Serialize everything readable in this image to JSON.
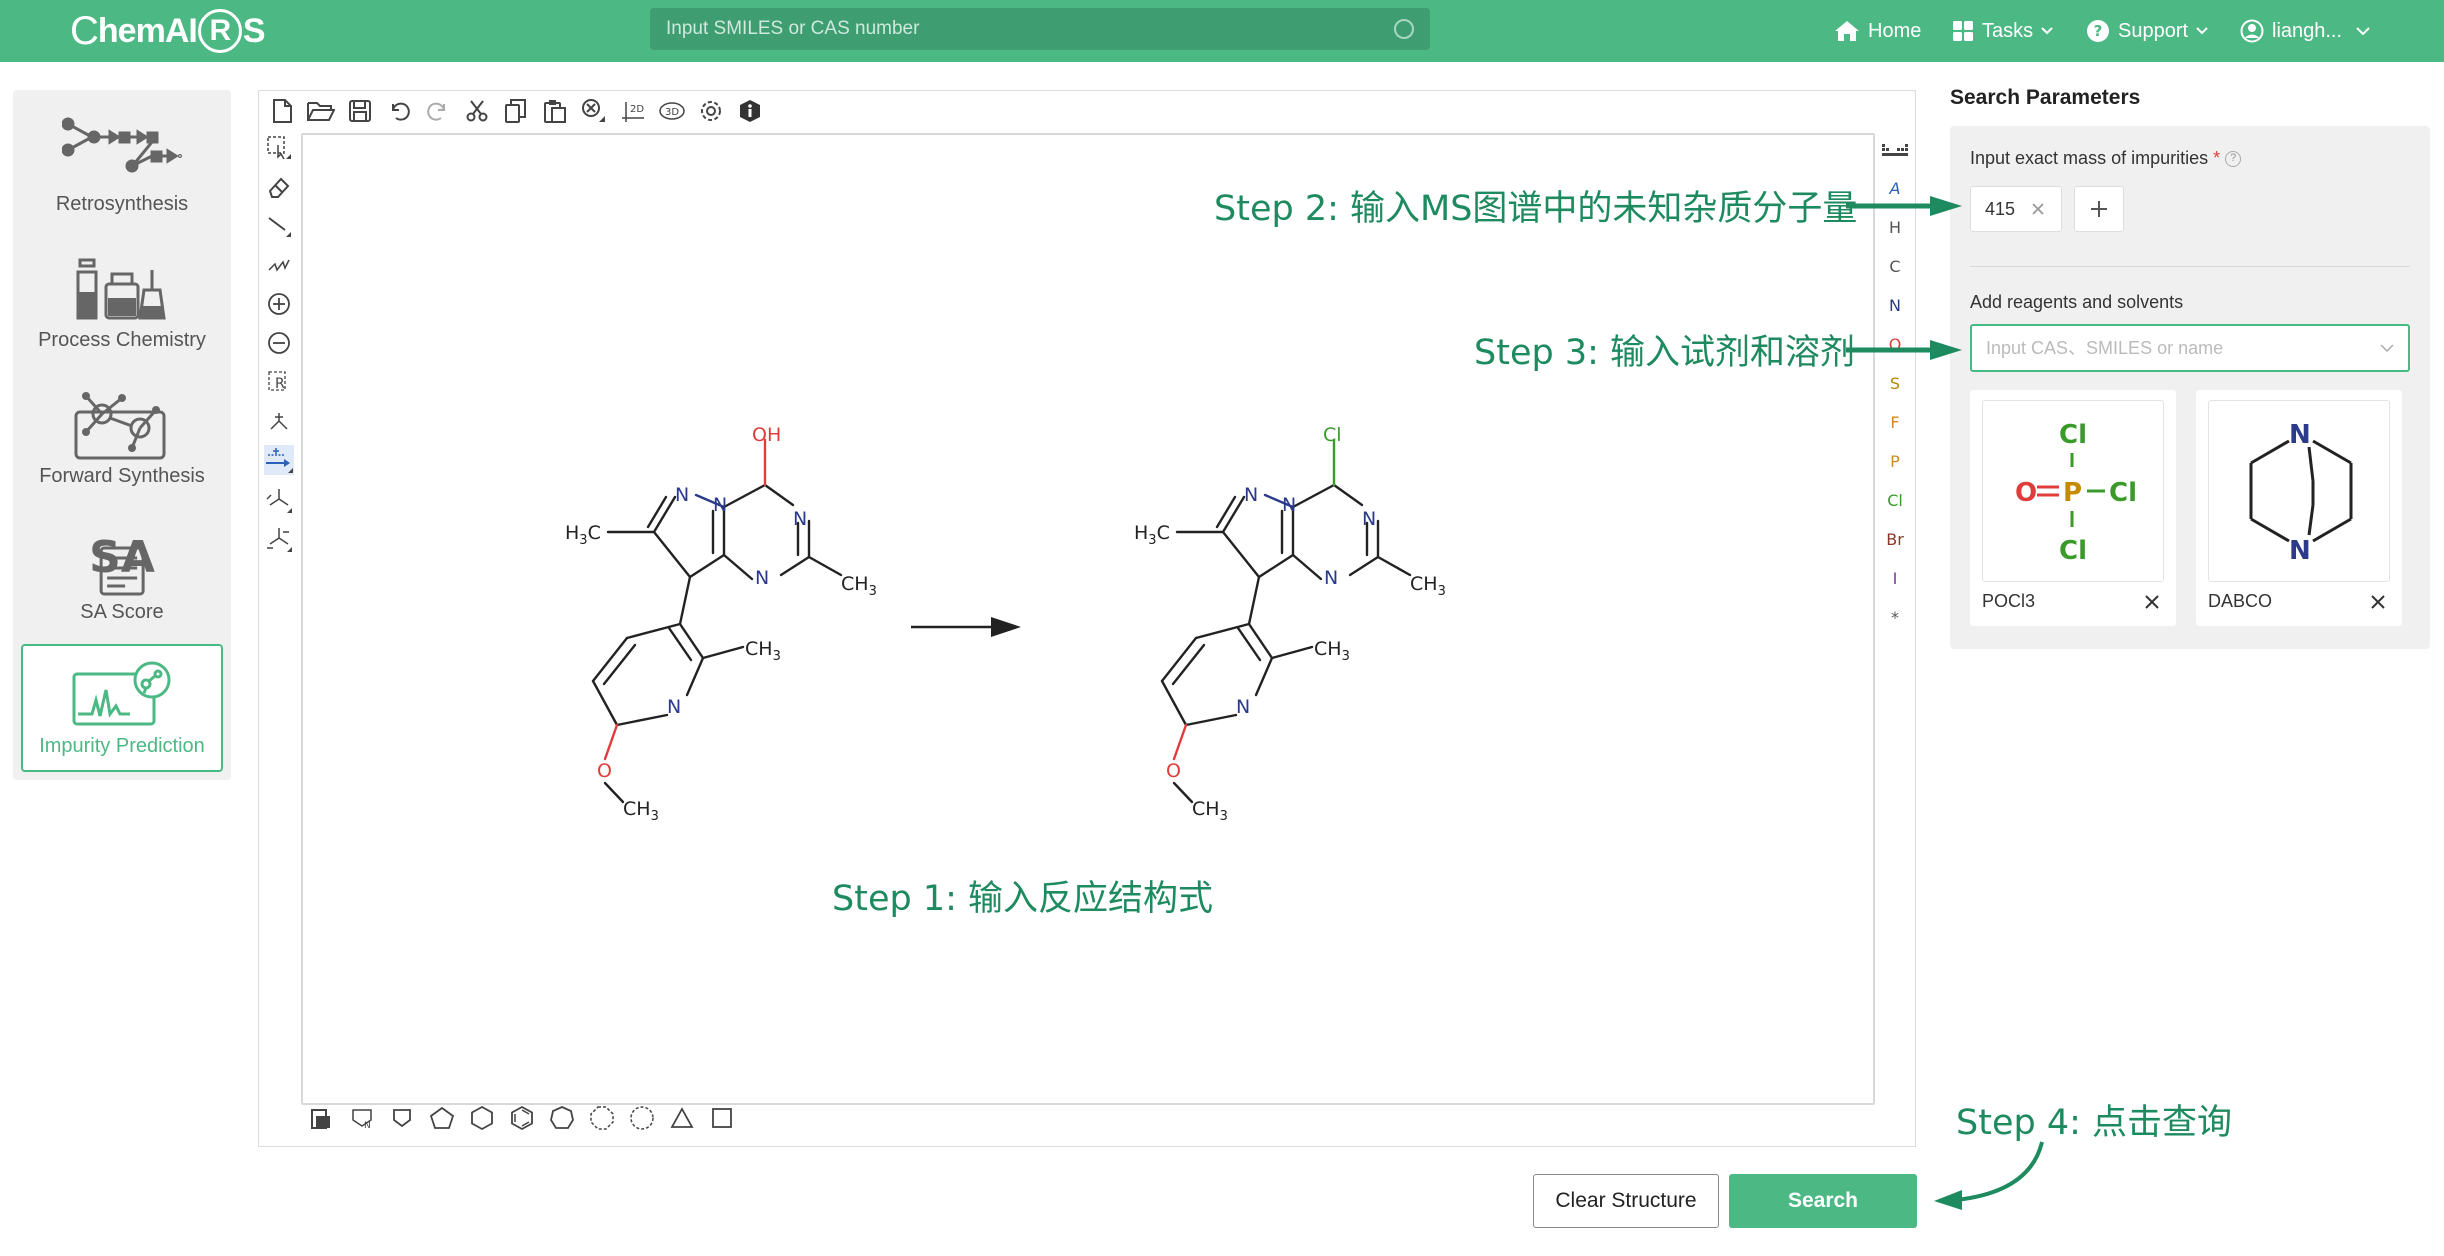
{
  "header": {
    "logo_text_1": "hem",
    "logo_text_2": "AI",
    "logo_ring": "R",
    "logo_text_3": "S",
    "search_placeholder": "Input SMILES or CAS number",
    "nav": {
      "home": "Home",
      "tasks": "Tasks",
      "support": "Support",
      "user": "liangh..."
    }
  },
  "sidebar": {
    "items": [
      {
        "label": "Retrosynthesis"
      },
      {
        "label": "Process Chemistry"
      },
      {
        "label": "Forward Synthesis"
      },
      {
        "label": "SA Score",
        "icon_text": "SA"
      },
      {
        "label": "Impurity Prediction",
        "active": true
      }
    ]
  },
  "editor": {
    "atoms": [
      "A",
      "H",
      "C",
      "N",
      "O",
      "S",
      "F",
      "P",
      "Cl",
      "Br",
      "I",
      "*"
    ],
    "toolbar_2d": "2D",
    "toolbar_3d": "3D",
    "molecule_labels": {
      "oh": "OH",
      "cl": "Cl",
      "n": "N",
      "o": "O",
      "ch3": "CH",
      "sub3": "3",
      "h3c_h": "H",
      "h3c_c": "C"
    }
  },
  "panel": {
    "title": "Search Parameters",
    "mass_label": "Input exact mass of impurities",
    "required_mark": "*",
    "help_mark": "?",
    "mass_value": "415",
    "reagents_label": "Add reagents and solvents",
    "reagent_placeholder": "Input CAS、SMILES or name",
    "reagents": [
      {
        "name": "POCl3"
      },
      {
        "name": "DABCO"
      }
    ],
    "struct_text": {
      "cl": "Cl",
      "o": "O",
      "p": "P",
      "n": "N"
    }
  },
  "buttons": {
    "clear": "Clear Structure",
    "search": "Search"
  },
  "annotations": {
    "step1": "Step 1: 输入反应结构式",
    "step2": "Step 2: 输入MS图谱中的未知杂质分子量",
    "step3": "Step 3: 输入试剂和溶剂",
    "step4": "Step 4: 点击查询"
  },
  "colors": {
    "brand": "#4cb884",
    "annotation": "#1e8a5f",
    "oxygen": "#e03c3c",
    "chlorine": "#3a9a2a",
    "nitrogen": "#2b3a8a",
    "phosphorus": "#c48a00"
  }
}
